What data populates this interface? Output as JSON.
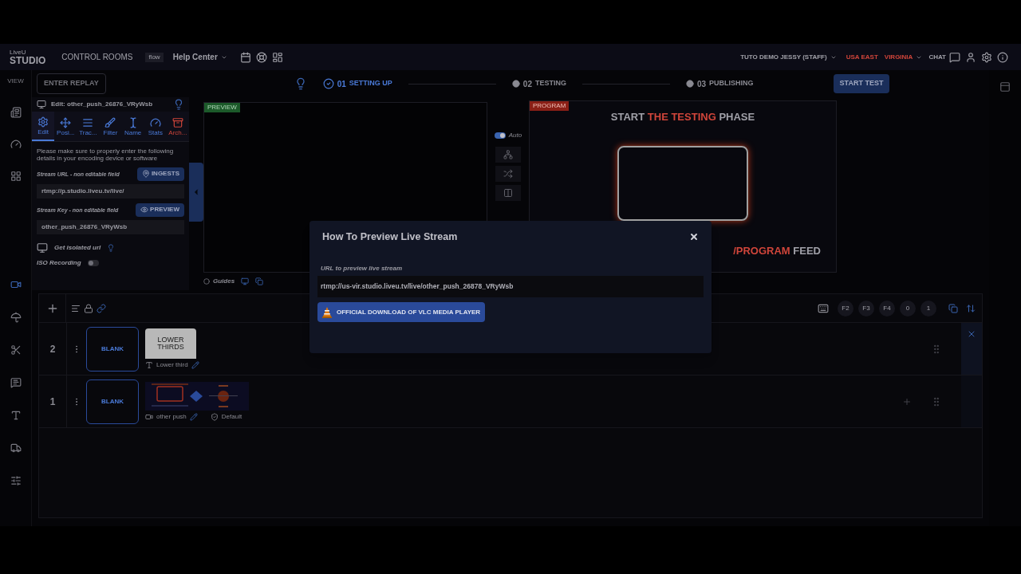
{
  "topbar": {
    "logo_small": "LiveU",
    "logo": "STUDIO",
    "nav": "CONTROL ROOMS",
    "badge": "flow",
    "help": "Help Center",
    "user": "TUTO DEMO JESSY (STAFF)",
    "region": "USA EAST",
    "location": "VIRGINIA",
    "chat": "CHAT"
  },
  "toolbar": {
    "view": "VIEW",
    "replay_button": "ENTER REPLAY",
    "steps": [
      {
        "number": "01",
        "label": "SETTING UP",
        "done": true
      },
      {
        "number": "02",
        "label": "TESTING",
        "done": false
      },
      {
        "number": "03",
        "label": "PUBLISHING",
        "done": false
      }
    ],
    "start_button": "START TEST"
  },
  "edit_panel": {
    "title": "Edit: other_push_26876_VRyWsb",
    "tabs": [
      {
        "label": "Edit",
        "selected": true,
        "kind": "normal"
      },
      {
        "label": "Posi...",
        "selected": false,
        "kind": "normal"
      },
      {
        "label": "Trac...",
        "selected": false,
        "kind": "normal"
      },
      {
        "label": "Filter",
        "selected": false,
        "kind": "normal"
      },
      {
        "label": "Name",
        "selected": false,
        "kind": "normal"
      },
      {
        "label": "Stats",
        "selected": false,
        "kind": "normal"
      },
      {
        "label": "Arch...",
        "selected": false,
        "kind": "danger"
      }
    ],
    "intro": "Please make sure to properly enter the following details in your encoding device or software",
    "stream_url": {
      "label": "Stream URL - non editable field",
      "button": "INGESTS",
      "value": "rtmp://p.studio.liveu.tv/live/"
    },
    "stream_key": {
      "label": "Stream Key - non editable field",
      "button": "PREVIEW",
      "value": "other_push_26876_VRyWsb"
    },
    "isolated_url": "Get isolated url",
    "iso_recording": {
      "label": "ISO Recording",
      "on": false
    }
  },
  "preview": {
    "tag": "PREVIEW",
    "guides": "Guides"
  },
  "switcher": {
    "auto_label": "Auto",
    "auto_on": true
  },
  "program": {
    "tag": "PROGRAM",
    "headline": [
      {
        "text": "START ",
        "highlight": false
      },
      {
        "text": "THE TESTING",
        "highlight": true
      },
      {
        "text": " PHASE",
        "highlight": false
      }
    ],
    "footer": [
      {
        "text": "/PROGRAM",
        "highlight": true
      },
      {
        "text": " FEED",
        "highlight": false
      }
    ]
  },
  "timeline": {
    "keys": [
      "F2",
      "F3",
      "F4",
      "0",
      "1"
    ],
    "layers": [
      {
        "number": "2",
        "slot": "BLANK",
        "closable": true,
        "items": [
          {
            "kind": "lower_third",
            "title": "LOWER THIRDS",
            "caption": "Lower third"
          }
        ]
      },
      {
        "number": "1",
        "slot": "BLANK",
        "closable": false,
        "items": [
          {
            "kind": "picture",
            "caption": "other push",
            "tag": "Default"
          }
        ]
      }
    ]
  },
  "modal": {
    "title": "How To Preview Live Stream",
    "url_label": "URL to preview live stream",
    "url": "rtmp://us-vir.studio.liveu.tv/live/other_push_26878_VRyWsb",
    "button": "OFFICIAL DOWNLOAD OF VLC MEDIA PLAYER"
  }
}
